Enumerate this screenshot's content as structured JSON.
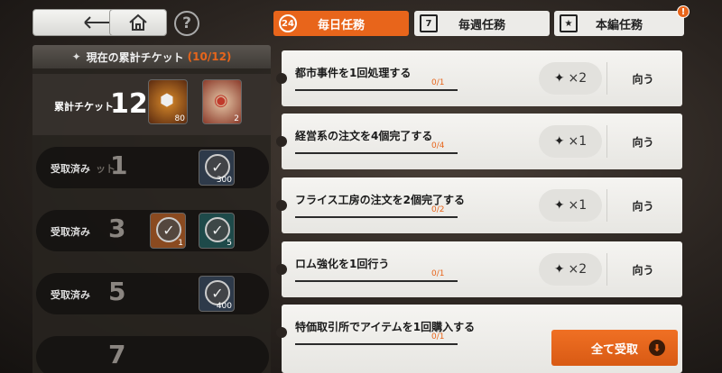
{
  "tabs": [
    {
      "label": "毎日任務",
      "icon_text": "24",
      "active": true
    },
    {
      "label": "毎週任務",
      "icon_text": "7",
      "active": false
    },
    {
      "label": "本編任務",
      "icon_text": "★",
      "active": false,
      "badge": "!"
    }
  ],
  "help_label": "?",
  "left": {
    "header_label": "現在の累計チケット",
    "header_count": "(10/12)",
    "current_label": "累計チケット",
    "current_number": "12",
    "current_items": [
      {
        "qty": "80",
        "icon": "coin-pile-icon"
      },
      {
        "qty": "2",
        "icon": "canned-food-icon"
      }
    ],
    "rows": [
      {
        "label": "受取済み",
        "ghost": "ット",
        "number": "1",
        "items": [
          {
            "qty": "300"
          }
        ]
      },
      {
        "label": "受取済み",
        "ghost": "",
        "number": "3",
        "items": [
          {
            "qty": "1"
          },
          {
            "qty": "5"
          }
        ]
      },
      {
        "label": "受取済み",
        "ghost": "",
        "number": "5",
        "items": [
          {
            "qty": "400"
          }
        ]
      },
      {
        "label": "",
        "ghost": "",
        "number": "7",
        "items": []
      }
    ]
  },
  "missions": [
    {
      "title": "都市事件を1回処理する",
      "progress": "0/1",
      "reward": "×2",
      "go_label": "向う"
    },
    {
      "title": "経営系の注文を4個完了する",
      "progress": "0/4",
      "reward": "×1",
      "go_label": "向う"
    },
    {
      "title": "フライス工房の注文を2個完了する",
      "progress": "0/2",
      "reward": "×1",
      "go_label": "向う"
    },
    {
      "title": "ロム強化を1回行う",
      "progress": "0/1",
      "reward": "×2",
      "go_label": "向う"
    },
    {
      "title": "特価取引所でアイテムを1回購入する",
      "progress": "0/1",
      "reward": "",
      "go_label": ""
    }
  ],
  "claim_all_label": "全て受取",
  "colors": {
    "accent": "#e8651b"
  }
}
